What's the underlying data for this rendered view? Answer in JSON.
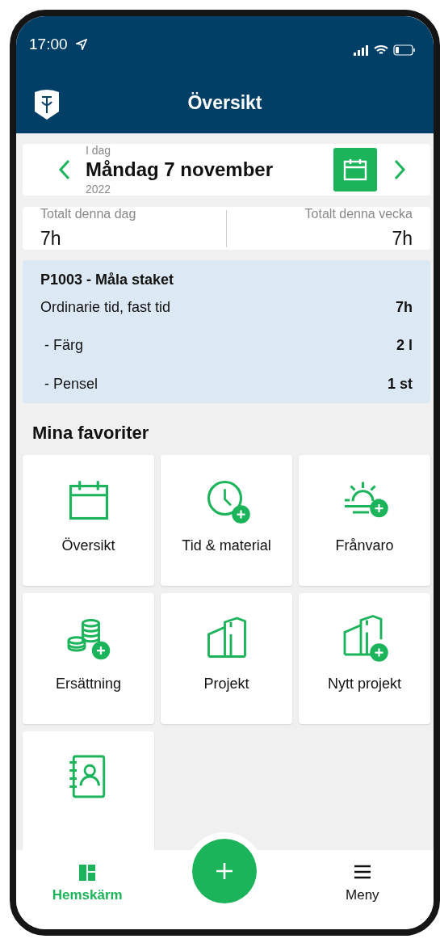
{
  "status_bar": {
    "time": "17:00"
  },
  "header": {
    "title": "Översikt"
  },
  "date_card": {
    "label": "I dag",
    "date": "Måndag 7 november",
    "year": "2022"
  },
  "totals": [
    {
      "label": "Totalt denna dag",
      "value": "7h"
    },
    {
      "label": "Totalt denna vecka",
      "value": "7h"
    }
  ],
  "entry": {
    "title": "P1003 - Måla staket",
    "lines": [
      {
        "label": "Ordinarie tid, fast tid",
        "value": "7h"
      },
      {
        "label": " - Färg",
        "value": "2 l"
      },
      {
        "label": " - Pensel",
        "value": "1 st"
      }
    ]
  },
  "favorites": {
    "title": "Mina favoriter",
    "items": [
      {
        "kind": "calendar",
        "label": "Översikt"
      },
      {
        "kind": "clock-add",
        "label": "Tid & material"
      },
      {
        "kind": "sun-add",
        "label": "Frånvaro"
      },
      {
        "kind": "coins-add",
        "label": "Ersättning"
      },
      {
        "kind": "buildings",
        "label": "Projekt"
      },
      {
        "kind": "buildings-add",
        "label": "Nytt projekt"
      },
      {
        "kind": "contacts"
      }
    ]
  },
  "bottom_nav": {
    "items": [
      {
        "kind": "home",
        "label": "Hemskärm",
        "selected": true
      },
      {
        "kind": "fab"
      },
      {
        "kind": "menu",
        "label": "Meny",
        "selected": false
      }
    ]
  }
}
